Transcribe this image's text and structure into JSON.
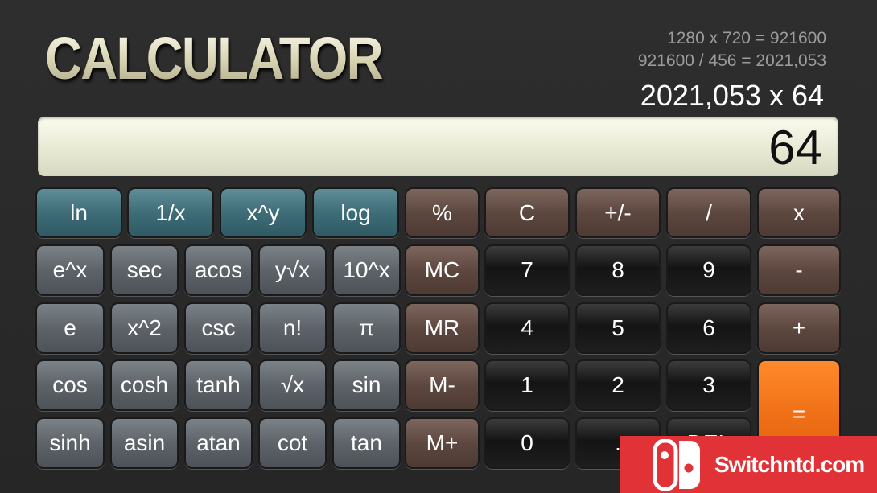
{
  "header": {
    "title": "CALCULATOR"
  },
  "history": [
    "1280 x 720 = 921600",
    "921600 / 456 = 2021,053"
  ],
  "expression": "2021,053 x 64",
  "display": "64",
  "keys": [
    {
      "label": "ln",
      "style": "teal"
    },
    {
      "label": "1/x",
      "style": "teal"
    },
    {
      "label": "x^y",
      "style": "teal"
    },
    {
      "label": "log",
      "style": "teal"
    },
    {
      "label": "%",
      "style": "brown"
    },
    {
      "label": "C",
      "style": "brown"
    },
    {
      "label": "+/-",
      "style": "brown"
    },
    {
      "label": "/",
      "style": "brown"
    },
    {
      "label": "x",
      "style": "brown"
    },
    {
      "label": "e^x",
      "style": "grey"
    },
    {
      "label": "sec",
      "style": "grey"
    },
    {
      "label": "acos",
      "style": "grey"
    },
    {
      "label": "y√x",
      "style": "grey"
    },
    {
      "label": "10^x",
      "style": "grey"
    },
    {
      "label": "MC",
      "style": "brown"
    },
    {
      "label": "7",
      "style": "black"
    },
    {
      "label": "8",
      "style": "black"
    },
    {
      "label": "9",
      "style": "black"
    },
    {
      "label": "-",
      "style": "brown"
    },
    {
      "label": "e",
      "style": "grey"
    },
    {
      "label": "x^2",
      "style": "grey"
    },
    {
      "label": "csc",
      "style": "grey"
    },
    {
      "label": "n!",
      "style": "grey"
    },
    {
      "label": "π",
      "style": "grey"
    },
    {
      "label": "MR",
      "style": "brown"
    },
    {
      "label": "4",
      "style": "black"
    },
    {
      "label": "5",
      "style": "black"
    },
    {
      "label": "6",
      "style": "black"
    },
    {
      "label": "+",
      "style": "brown"
    },
    {
      "label": "cos",
      "style": "grey"
    },
    {
      "label": "cosh",
      "style": "grey"
    },
    {
      "label": "tanh",
      "style": "grey"
    },
    {
      "label": "√x",
      "style": "grey"
    },
    {
      "label": "sin",
      "style": "grey"
    },
    {
      "label": "M-",
      "style": "brown"
    },
    {
      "label": "1",
      "style": "black"
    },
    {
      "label": "2",
      "style": "black"
    },
    {
      "label": "3",
      "style": "black"
    },
    {
      "label": "=",
      "style": "orange"
    },
    {
      "label": "sinh",
      "style": "grey"
    },
    {
      "label": "asin",
      "style": "grey"
    },
    {
      "label": "atan",
      "style": "grey"
    },
    {
      "label": "cot",
      "style": "grey"
    },
    {
      "label": "tan",
      "style": "grey"
    },
    {
      "label": "M+",
      "style": "brown"
    },
    {
      "label": "0",
      "style": "black"
    },
    {
      "label": ".",
      "style": "black"
    },
    {
      "label": "DEL",
      "style": "black"
    }
  ],
  "watermark": {
    "text": "Switchntd.com",
    "color": "#e03237"
  }
}
